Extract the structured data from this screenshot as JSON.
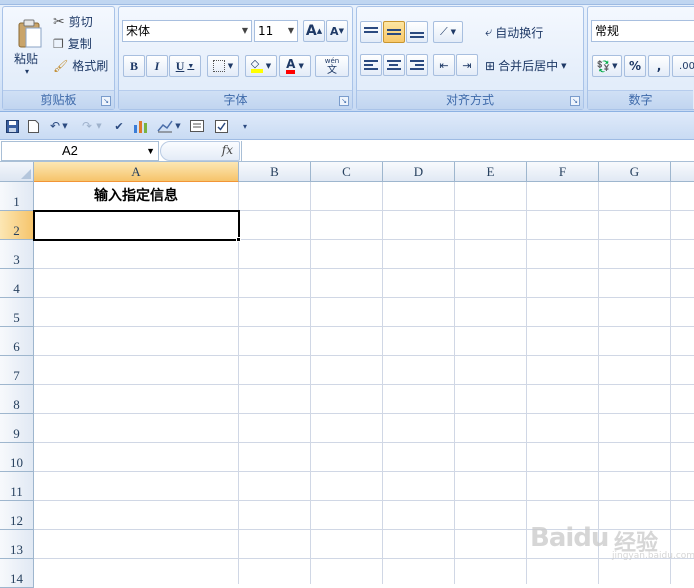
{
  "ribbon": {
    "clipboard": {
      "paste_label": "粘贴",
      "cut_label": "剪切",
      "copy_label": "复制",
      "format_painter_label": "格式刷",
      "group_label": "剪贴板"
    },
    "font": {
      "font_name": "宋体",
      "font_size": "11",
      "grow_label": "A",
      "shrink_label": "A",
      "bold_label": "B",
      "italic_label": "I",
      "underline_label": "U",
      "font_color_label": "A",
      "phonetic_top": "wén",
      "phonetic_char": "文",
      "group_label": "字体"
    },
    "alignment": {
      "wrap_text_label": "自动换行",
      "merge_center_label": "合并后居中",
      "group_label": "对齐方式"
    },
    "number": {
      "format_value": "常规",
      "percent_label": "%",
      "comma_label": ",",
      "decimal_label": ".00",
      "group_label": "数字"
    }
  },
  "formula_bar": {
    "name_box": "A2",
    "fx_label": "fx",
    "formula": ""
  },
  "sheet": {
    "columns": [
      "A",
      "B",
      "C",
      "D",
      "E",
      "F",
      "G"
    ],
    "rows": [
      "1",
      "2",
      "3",
      "4",
      "5",
      "6",
      "7",
      "8",
      "9",
      "10",
      "11",
      "12",
      "13",
      "14"
    ],
    "cells": {
      "A1": "输入指定信息",
      "A2": ""
    },
    "selected_cell": "A2"
  },
  "watermark": {
    "brand": "Baidu",
    "cn": "经验",
    "sub": "jingyan.baidu.com"
  },
  "colors": {
    "selection_header": "#f6c46b",
    "grid_line": "#d0d7e5",
    "ribbon_text": "#15428b"
  }
}
